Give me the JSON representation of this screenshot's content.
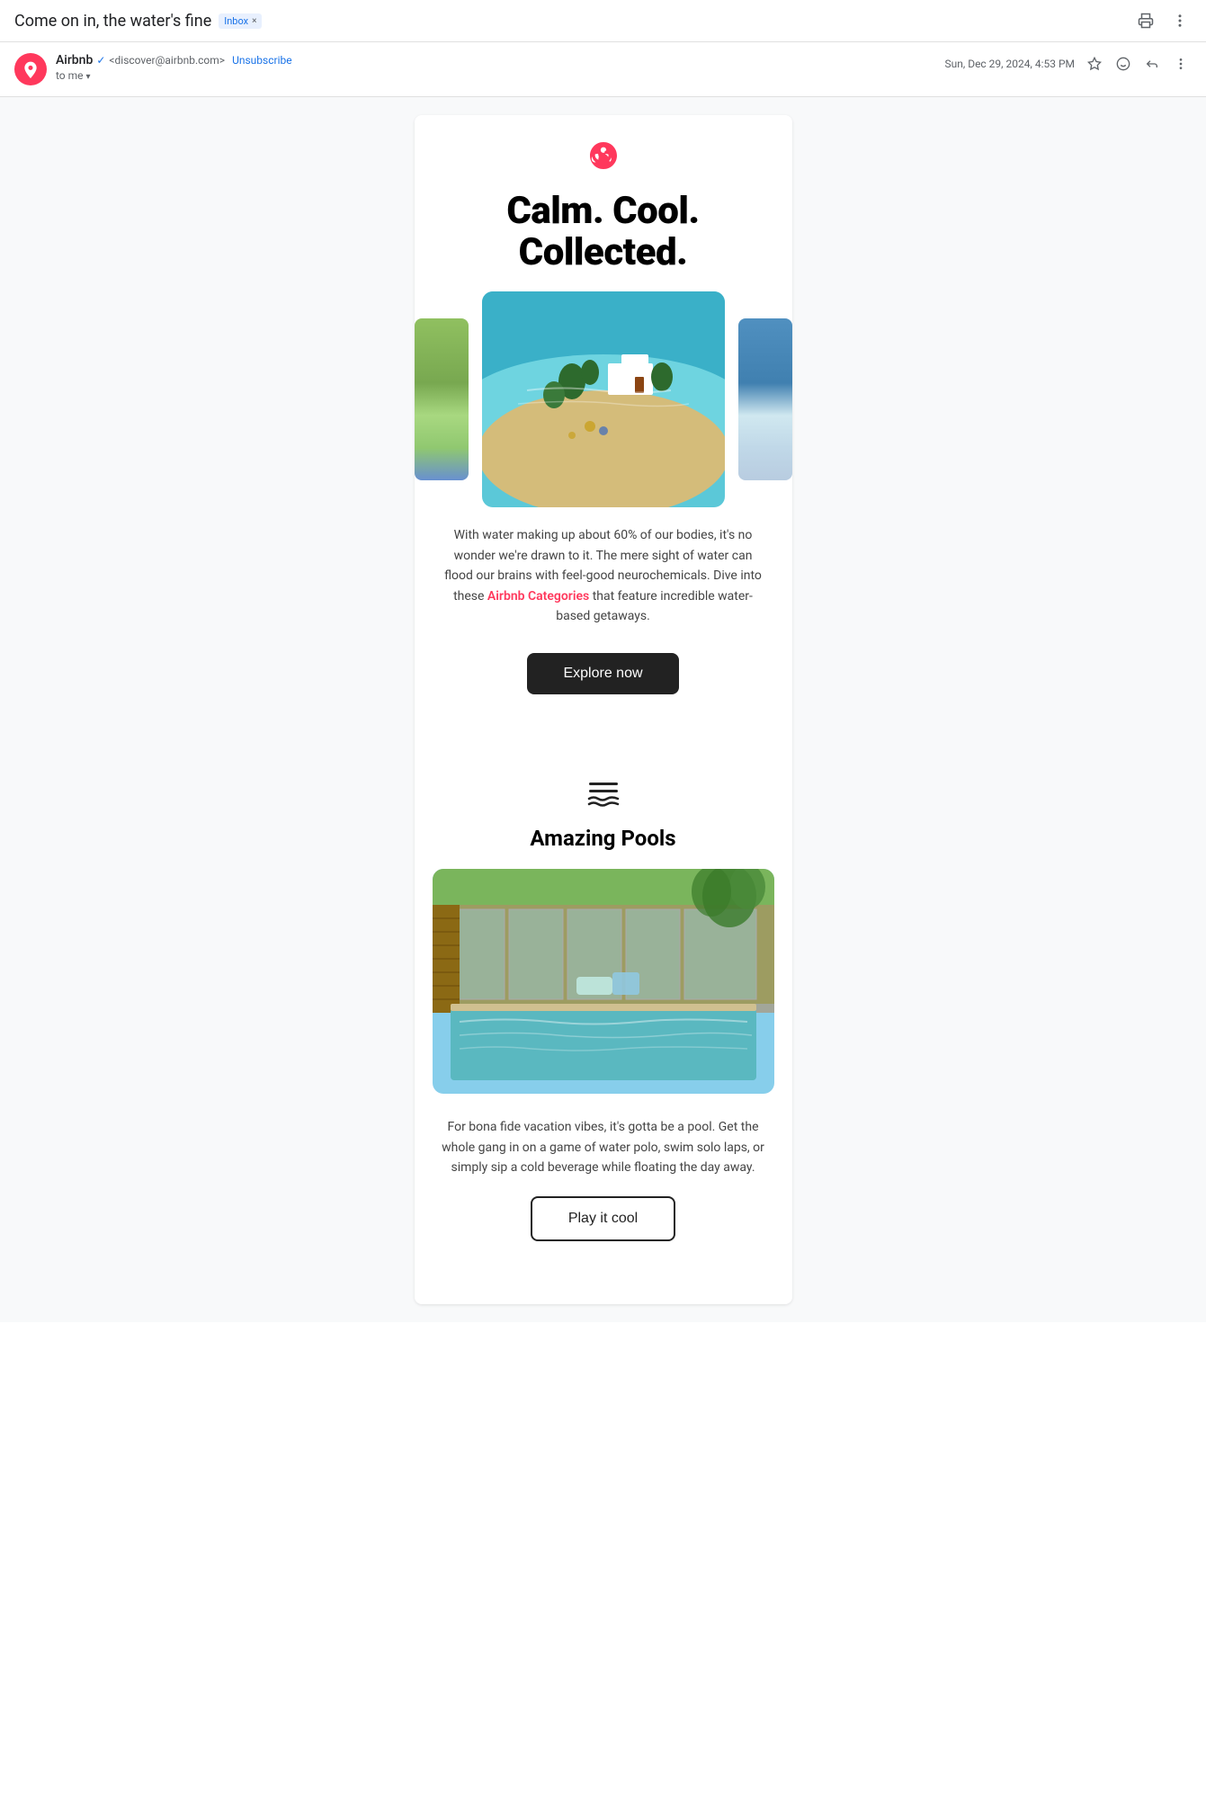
{
  "subject": {
    "text": "Come on in, the water's fine",
    "inbox_badge": "Inbox",
    "close_label": "×"
  },
  "header_actions": {
    "print_icon": "🖨",
    "more_icon": "⋮"
  },
  "sender": {
    "name": "Airbnb",
    "verified": true,
    "email": "<discover@airbnb.com>",
    "unsubscribe_label": "Unsubscribe",
    "to": "to me",
    "date": "Sun, Dec 29, 2024, 4:53 PM"
  },
  "sender_actions": {
    "star_icon": "☆",
    "emoji_icon": "☺",
    "reply_icon": "↩",
    "more_icon": "⋮"
  },
  "email": {
    "logo_alt": "Airbnb logo",
    "headline_line1": "Calm. Cool.",
    "headline_line2": "Collected.",
    "description": "With water making up about 60% of our bodies, it's no wonder we're drawn to it. The mere sight of water can flood our brains with feel-good neurochemicals. Dive into these",
    "airbnb_text": "Airbnb",
    "categories_text": "Categories",
    "description_end": "that feature incredible water-based getaways.",
    "explore_btn": "Explore now",
    "pool_section": {
      "title": "Amazing Pools",
      "description": "For bona fide vacation vibes, it's gotta be a pool. Get the whole gang in on a game of water polo, swim solo laps, or simply sip a cold beverage while floating the day away.",
      "cta_btn": "Play it cool"
    }
  }
}
